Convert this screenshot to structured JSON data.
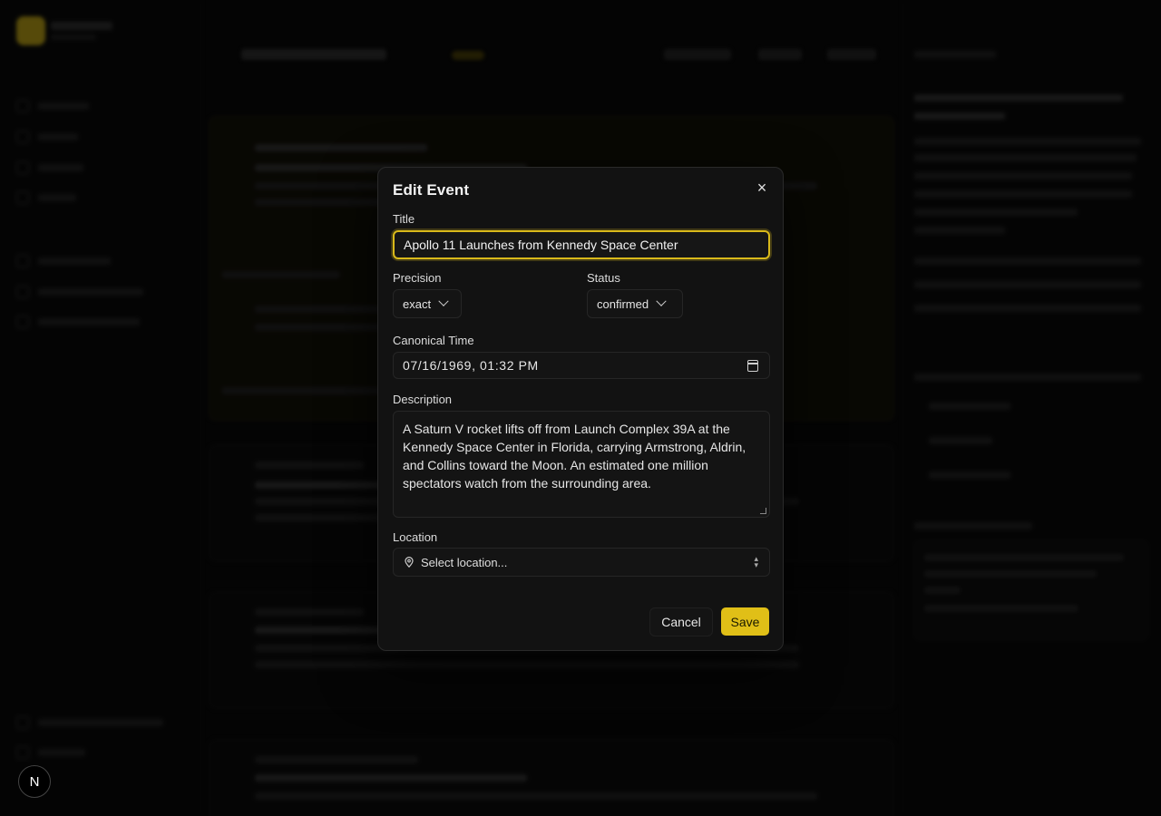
{
  "modal": {
    "title": "Edit Event",
    "close_symbol": "×",
    "title_label": "Title",
    "title_value": "Apollo 11 Launches from Kennedy Space Center",
    "precision_label": "Precision",
    "precision_value": "exact",
    "status_label": "Status",
    "status_value": "confirmed",
    "canonical_time_label": "Canonical Time",
    "canonical_time_value": "07/16/1969, 01:32 PM",
    "description_label": "Description",
    "description_value": "A Saturn V rocket lifts off from Launch Complex 39A at the Kennedy Space Center in Florida, carrying Armstrong, Aldrin, and Collins toward the Moon. An estimated one million spectators watch from the surrounding area.",
    "location_label": "Location",
    "location_placeholder": "Select location...",
    "cancel_label": "Cancel",
    "save_label": "Save"
  },
  "avatar": {
    "initial": "N"
  },
  "colors": {
    "accent": "#e0bf17",
    "modal_bg": "#121212",
    "page_bg": "#0b0b0b"
  }
}
